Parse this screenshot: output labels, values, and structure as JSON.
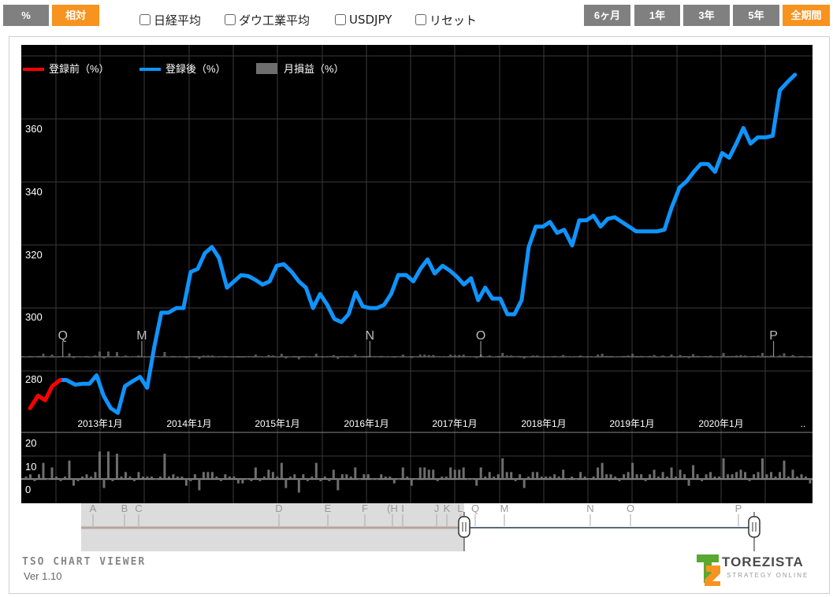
{
  "toolbar": {
    "mode_buttons": [
      {
        "label": "%",
        "active": false
      },
      {
        "label": "相対",
        "active": true
      }
    ],
    "checkboxes": [
      {
        "label": "日経平均",
        "checked": false
      },
      {
        "label": "ダウ工業平均",
        "checked": false
      },
      {
        "label": "USDJPY",
        "checked": false
      },
      {
        "label": "リセット",
        "checked": false
      }
    ],
    "period_buttons": [
      {
        "label": "6ヶ月",
        "active": false
      },
      {
        "label": "1年",
        "active": false
      },
      {
        "label": "3年",
        "active": false
      },
      {
        "label": "5年",
        "active": false
      },
      {
        "label": "全期間",
        "active": true
      }
    ]
  },
  "colors": {
    "before": "#ff0000",
    "after": "#0f94ff",
    "bars": "#6e6e6e",
    "accent": "#f7931e",
    "button": "#808080"
  },
  "chart_data": {
    "type": "line",
    "legend": [
      {
        "name": "登録前（%）",
        "color": "#ff0000"
      },
      {
        "name": "登録後（%）",
        "color": "#0f94ff"
      },
      {
        "name": "月損益（%）",
        "color": "#6e6e6e"
      }
    ],
    "legend_position": "top-left",
    "main": {
      "ylim": [
        262,
        378
      ],
      "yticks": [
        "300",
        "320",
        "340",
        "360"
      ],
      "extra_ytick": "280",
      "xticks": [
        "2013年1月",
        "2014年1月",
        "2015年1月",
        "2016年1月",
        "2017年1月",
        "2018年1月",
        "2019年1月",
        "2020年1月"
      ],
      "xtick_tail": "..",
      "before_series": {
        "name": "登録前（%）",
        "x": [
          2012.21,
          2012.3,
          2012.38,
          2012.46,
          2012.55
        ],
        "y": [
          270.5,
          274.5,
          273.0,
          277.5,
          279.5
        ]
      },
      "after_series": {
        "name": "登録後（%）",
        "x": [
          2012.55,
          2012.62,
          2012.72,
          2012.8,
          2012.88,
          2012.96,
          2013.04,
          2013.12,
          2013.2,
          2013.28,
          2013.36,
          2013.45,
          2013.53,
          2013.61,
          2013.69,
          2013.77,
          2013.86,
          2013.94,
          2014.02,
          2014.1,
          2014.18,
          2014.26,
          2014.34,
          2014.43,
          2014.51,
          2014.59,
          2014.67,
          2014.75,
          2014.83,
          2014.91,
          2014.99,
          2015.07,
          2015.16,
          2015.24,
          2015.32,
          2015.4,
          2015.48,
          2015.56,
          2015.64,
          2015.72,
          2015.8,
          2015.88,
          2015.96,
          2016.04,
          2016.12,
          2016.2,
          2016.28,
          2016.36,
          2016.45,
          2016.53,
          2016.61,
          2016.69,
          2016.77,
          2016.86,
          2016.94,
          2017.02,
          2017.1,
          2017.18,
          2017.26,
          2017.34,
          2017.42,
          2017.51,
          2017.59,
          2017.67,
          2017.75,
          2017.83,
          2017.91,
          2017.99,
          2018.07,
          2018.15,
          2018.23,
          2018.32,
          2018.4,
          2018.48,
          2018.56,
          2018.64,
          2018.72,
          2018.8,
          2018.88,
          2018.96,
          2019.04,
          2019.12,
          2019.2,
          2019.28,
          2019.36,
          2019.44,
          2019.53,
          2019.61,
          2019.69,
          2019.77,
          2019.85,
          2019.93,
          2020.01,
          2020.09,
          2020.17,
          2020.25,
          2020.33,
          2020.41,
          2020.5,
          2020.58,
          2020.66,
          2020.74,
          2020.83
        ],
        "y": [
          279.5,
          279.5,
          278.0,
          278.3,
          278.3,
          281.0,
          274.5,
          270.5,
          269.0,
          277.5,
          279.0,
          280.5,
          277.0,
          290.0,
          301.0,
          301.0,
          302.5,
          302.5,
          314.0,
          315.0,
          320.0,
          322.0,
          318.5,
          309.0,
          311.0,
          313.0,
          312.7,
          311.5,
          310.0,
          311.0,
          316.0,
          316.5,
          314.0,
          311.0,
          309.0,
          302.5,
          307.0,
          303.5,
          299.0,
          298.0,
          300.5,
          307.5,
          303.0,
          302.5,
          302.5,
          303.5,
          307.0,
          313.0,
          313.0,
          311.0,
          315.0,
          318.0,
          313.5,
          316.0,
          314.5,
          312.5,
          310.0,
          312.0,
          305.0,
          309.0,
          305.5,
          305.5,
          300.5,
          300.5,
          305.0,
          322.0,
          328.5,
          328.5,
          330.0,
          326.5,
          327.5,
          322.5,
          330.5,
          330.5,
          332.0,
          328.5,
          331.0,
          331.5,
          330.0,
          328.5,
          327.0,
          327.0,
          327.0,
          327.0,
          327.5,
          334.5,
          341.0,
          343.0,
          346.0,
          348.5,
          348.5,
          346.0,
          352.0,
          350.5,
          355.0,
          360.0,
          355.0,
          357.0,
          357.0,
          357.5,
          372.0,
          374.5,
          377.0,
          376.5
        ]
      },
      "markers": [
        {
          "label": "Q",
          "x": 2012.58
        },
        {
          "label": "M",
          "x": 2013.47
        },
        {
          "label": "N",
          "x": 2016.04
        },
        {
          "label": "O",
          "x": 2017.29
        },
        {
          "label": "P",
          "x": 2020.59
        }
      ]
    },
    "monthly_bars": {
      "name": "月損益（%）",
      "ylim": [
        -10,
        30
      ],
      "yticks": [
        "20",
        "10",
        "0"
      ],
      "values": [
        1,
        2,
        -1,
        2,
        7,
        0,
        5,
        1,
        -1,
        1,
        8,
        -3,
        -1,
        1,
        2,
        1,
        3,
        12,
        -4,
        12,
        -1,
        11,
        1,
        3,
        1,
        -1,
        3,
        1,
        1,
        1,
        0,
        1,
        11,
        1,
        2,
        1,
        1,
        -3,
        -1,
        2,
        -5,
        3,
        3,
        3,
        1,
        -1,
        2,
        1,
        1,
        -2,
        -2,
        0,
        -1,
        5,
        -1,
        1,
        4,
        3,
        1,
        7,
        -4,
        1,
        2,
        -6,
        2,
        -1,
        1,
        7,
        -1,
        1,
        -1,
        4,
        -5,
        2,
        2,
        1,
        5,
        0,
        2,
        2,
        0,
        0,
        2,
        1,
        1,
        -2,
        0,
        5,
        1,
        -3,
        0,
        5,
        5,
        4,
        4,
        -1,
        1,
        1,
        5,
        4,
        4,
        5,
        0,
        0,
        -3,
        5,
        1,
        3,
        1,
        2,
        9,
        3,
        3,
        -1,
        2,
        -4,
        1,
        3,
        3,
        1,
        1,
        1,
        2,
        1,
        4,
        0,
        1,
        0,
        3,
        1,
        0,
        1,
        5,
        7,
        2,
        2,
        1,
        -1,
        2,
        3,
        7,
        2,
        2,
        -1,
        2,
        4,
        1,
        3,
        1,
        5,
        1,
        4,
        2,
        -3,
        6,
        2,
        -1,
        2,
        3,
        1,
        1,
        9,
        2,
        2,
        3,
        4,
        3,
        -1,
        2,
        3,
        9,
        2,
        3,
        1,
        3,
        8,
        1,
        4,
        1,
        2,
        1,
        -2
      ]
    },
    "navigator": {
      "markers": [
        "A",
        "B",
        "C",
        "D",
        "E",
        "F",
        "(H",
        "I",
        "J",
        "K",
        "L",
        "Q",
        "M",
        "N",
        "O",
        "P"
      ]
    }
  },
  "footer": {
    "brand": "TSO CHART VIEWER",
    "version": "Ver 1.10",
    "logo_name": "TOREZISTA",
    "logo_sub": "STRATEGY ONLINE"
  }
}
